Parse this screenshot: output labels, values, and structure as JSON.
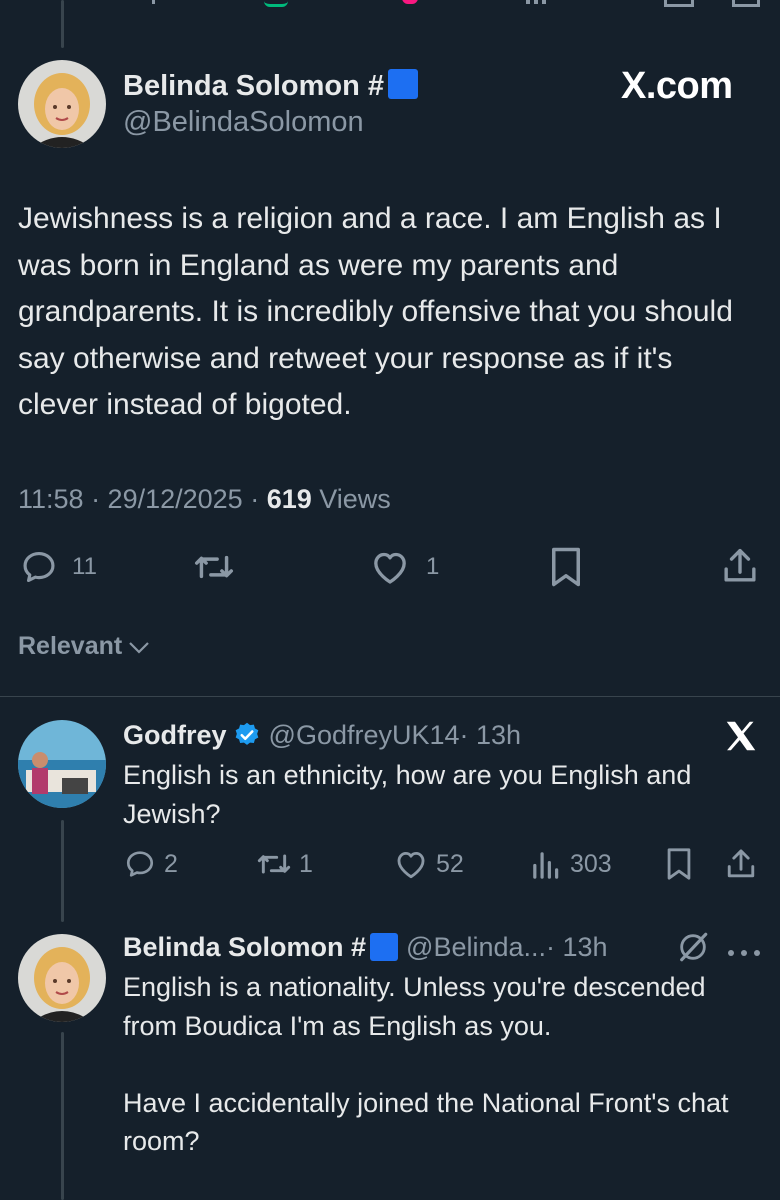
{
  "main_tweet": {
    "author_name": "Belinda Solomon #",
    "author_handle": "@BelindaSolomon",
    "watermark": "X.com",
    "text": "Jewishness is a religion and a race. I am English as I was born in England as were my parents and grandparents. It is incredibly offensive that you should say otherwise and retweet your response as if it's clever instead of bigoted.",
    "timestamp": "11:58 · 29/12/2025 · ",
    "views_count": "619",
    "views_label": " Views",
    "actions": {
      "reply_count": "11",
      "retweet_count": "",
      "like_count": "1"
    }
  },
  "sort": {
    "label": "Relevant"
  },
  "replies": [
    {
      "author_name": "Godfrey",
      "author_handle": "@GodfreyUK14",
      "time": " · 13h",
      "text": "English is an ethnicity, how are you English and Jewish?",
      "actions": {
        "reply_count": "2",
        "retweet_count": "1",
        "like_count": "52",
        "views_count": "303"
      }
    },
    {
      "author_name": "Belinda Solomon #",
      "author_handle": "@Belinda...",
      "time": " · 13h",
      "text": "English is a nationality.  Unless you're descended from Boudica I'm as English as you.\n\nHave I accidentally joined the National Front's chat room?"
    }
  ],
  "colors": {
    "background": "#15202b",
    "text": "#e7e9ea",
    "muted": "#8b98a5",
    "verified": "#1d9bf0",
    "flag": "#1d6ff2"
  }
}
